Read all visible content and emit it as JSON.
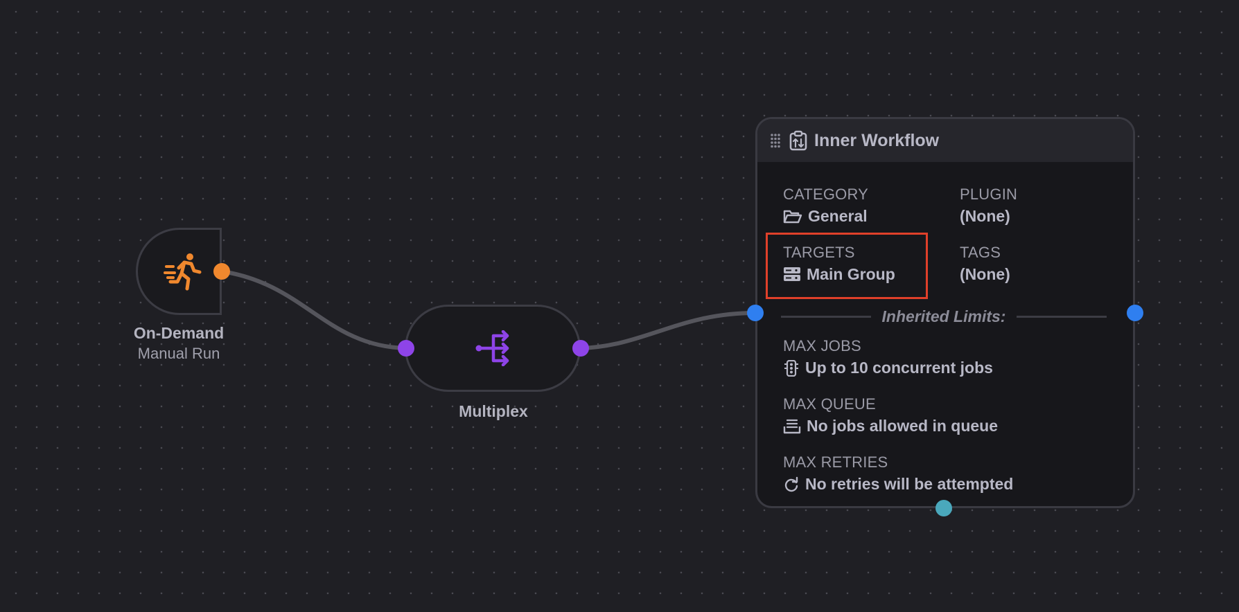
{
  "trigger": {
    "title": "On-Demand",
    "subtitle": "Manual Run",
    "icon": "running-person-icon",
    "color": "#f0882e"
  },
  "multiplex": {
    "title": "Multiplex",
    "icon": "multiplex-arrows-icon",
    "color": "#8e44e8"
  },
  "workflow": {
    "title": "Inner Workflow",
    "fields": {
      "category": {
        "label": "CATEGORY",
        "value": "General",
        "icon": "folder-open-icon"
      },
      "plugin": {
        "label": "PLUGIN",
        "value": "(None)"
      },
      "targets": {
        "label": "TARGETS",
        "value": "Main Group",
        "icon": "server-icon"
      },
      "tags": {
        "label": "TAGS",
        "value": "(None)"
      }
    },
    "divider": "Inherited Limits:",
    "limits": {
      "max_jobs": {
        "label": "MAX JOBS",
        "value": "Up to 10 concurrent jobs",
        "icon": "traffic-light-icon"
      },
      "max_queue": {
        "label": "MAX QUEUE",
        "value": "No jobs allowed in queue",
        "icon": "tray-icon"
      },
      "max_retries": {
        "label": "MAX RETRIES",
        "value": "No retries will be attempted",
        "icon": "redo-icon"
      }
    }
  },
  "colors": {
    "background": "#1f1f24",
    "edge": "#55555c",
    "port_blue": "#2f7ff0",
    "port_teal": "#4aa8bc",
    "highlight": "#e0402a"
  }
}
